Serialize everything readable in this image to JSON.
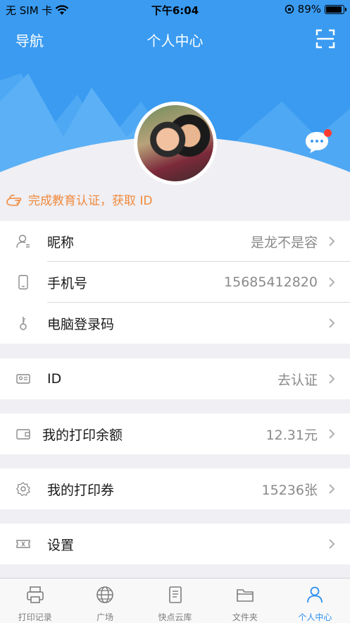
{
  "status_bar": {
    "carrier": "无 SIM 卡",
    "time": "下午6:04",
    "battery": "89%"
  },
  "nav": {
    "left": "导航",
    "title": "个人中心",
    "right_icon": "scan-icon"
  },
  "profile": {
    "verify_text": "完成教育认证，获取 ID",
    "message_badge": true
  },
  "rows": {
    "nickname": {
      "label": "昵称",
      "value": "是龙不是容"
    },
    "phone": {
      "label": "手机号",
      "value": "15685412820"
    },
    "pc_code": {
      "label": "电脑登录码",
      "value": ""
    },
    "id": {
      "label": "ID",
      "value": "去认证"
    },
    "balance": {
      "label": "我的打印余额",
      "value": "12.31元"
    },
    "coupon": {
      "label": "我的打印券",
      "value": "15236张"
    },
    "settings": {
      "label": "设置",
      "value": ""
    }
  },
  "tabs": [
    {
      "label": "打印记录",
      "icon": "printer-icon",
      "active": false
    },
    {
      "label": "广场",
      "icon": "globe-icon",
      "active": false
    },
    {
      "label": "快点云库",
      "icon": "document-icon",
      "active": false
    },
    {
      "label": "文件夹",
      "icon": "folder-icon",
      "active": false
    },
    {
      "label": "个人中心",
      "icon": "person-icon",
      "active": true
    }
  ],
  "colors": {
    "primary": "#3a9bf1",
    "accent_orange": "#f08a3c",
    "badge_red": "#ff3b30",
    "tab_active": "#2b8ff0"
  }
}
